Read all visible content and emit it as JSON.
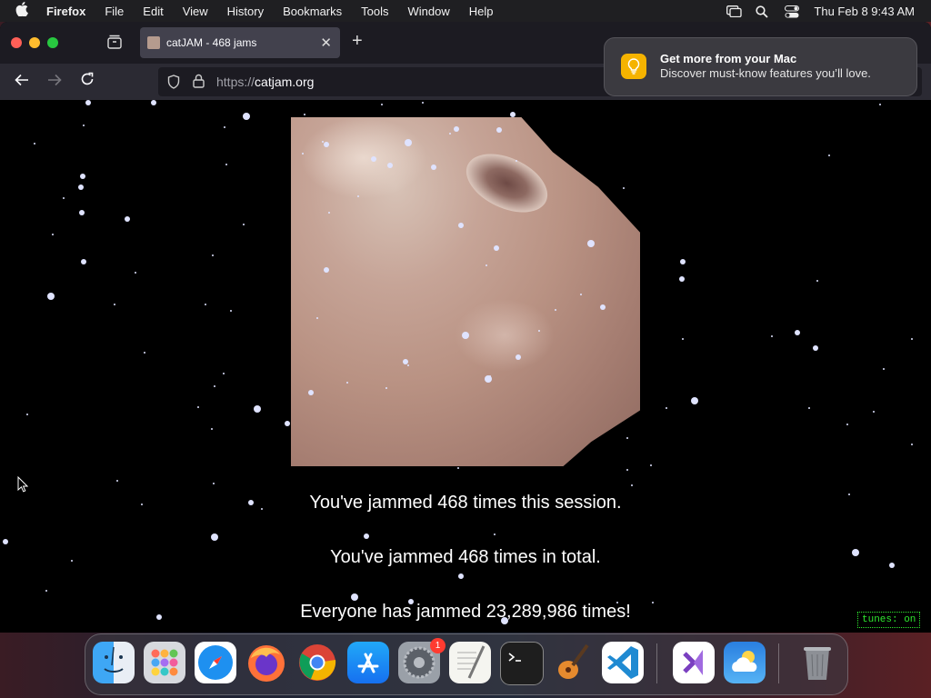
{
  "menubar": {
    "app_name": "Firefox",
    "menus": [
      "File",
      "Edit",
      "View",
      "History",
      "Bookmarks",
      "Tools",
      "Window",
      "Help"
    ],
    "clock": "Thu Feb 8  9:43 AM"
  },
  "browser": {
    "tab_title": "catJAM - 468 jams",
    "url_protocol": "https://",
    "url_host": "catjam.org"
  },
  "page": {
    "session_message": "You've jammed 468 times this session.",
    "total_message": "You've jammed 468 times in total.",
    "everyone_message": "Everyone has jammed 23,289,986 times!",
    "tunes_toggle": "tunes: on"
  },
  "notification": {
    "title": "Get more from your Mac",
    "body": "Discover must-know features you’ll love."
  },
  "dock": {
    "apps": [
      {
        "name": "Finder",
        "icon": "finder-icon"
      },
      {
        "name": "Launchpad",
        "icon": "launchpad-icon"
      },
      {
        "name": "Safari",
        "icon": "safari-icon"
      },
      {
        "name": "Firefox",
        "icon": "firefox-icon"
      },
      {
        "name": "Chrome",
        "icon": "chrome-icon"
      },
      {
        "name": "App Store",
        "icon": "app-store-icon"
      },
      {
        "name": "System Settings",
        "icon": "settings-icon",
        "badge": "1"
      },
      {
        "name": "TextEdit",
        "icon": "textedit-icon"
      },
      {
        "name": "Terminal",
        "icon": "terminal-icon"
      },
      {
        "name": "GarageBand",
        "icon": "garageband-icon"
      },
      {
        "name": "VS Code",
        "icon": "vscode-icon"
      },
      {
        "name": "Visual Studio",
        "icon": "visual-studio-icon"
      },
      {
        "name": "Weather",
        "icon": "weather-icon"
      },
      {
        "name": "Trash",
        "icon": "trash-icon"
      }
    ],
    "settings_badge": "1"
  }
}
